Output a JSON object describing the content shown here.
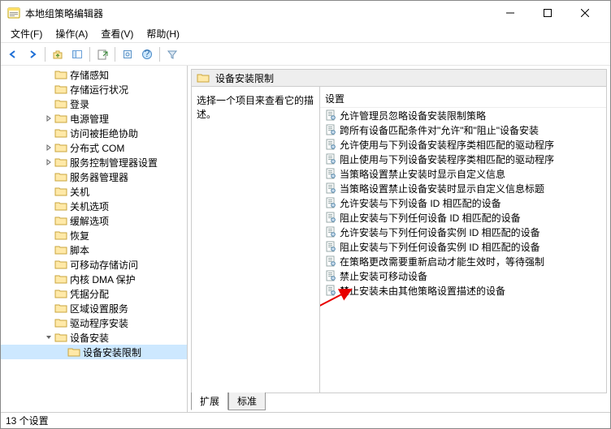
{
  "window": {
    "title": "本地组策略编辑器"
  },
  "menu": {
    "file": "文件(F)",
    "action": "操作(A)",
    "view": "查看(V)",
    "help": "帮助(H)"
  },
  "tree": {
    "items": [
      {
        "label": "存储感知",
        "indent": 3,
        "exp": ""
      },
      {
        "label": "存储运行状况",
        "indent": 3,
        "exp": ""
      },
      {
        "label": "登录",
        "indent": 3,
        "exp": ""
      },
      {
        "label": "电源管理",
        "indent": 3,
        "exp": ">"
      },
      {
        "label": "访问被拒绝协助",
        "indent": 3,
        "exp": ""
      },
      {
        "label": "分布式 COM",
        "indent": 3,
        "exp": ">"
      },
      {
        "label": "服务控制管理器设置",
        "indent": 3,
        "exp": ">"
      },
      {
        "label": "服务器管理器",
        "indent": 3,
        "exp": ""
      },
      {
        "label": "关机",
        "indent": 3,
        "exp": ""
      },
      {
        "label": "关机选项",
        "indent": 3,
        "exp": ""
      },
      {
        "label": "缓解选项",
        "indent": 3,
        "exp": ""
      },
      {
        "label": "恢复",
        "indent": 3,
        "exp": ""
      },
      {
        "label": "脚本",
        "indent": 3,
        "exp": ""
      },
      {
        "label": "可移动存储访问",
        "indent": 3,
        "exp": ""
      },
      {
        "label": "内核 DMA 保护",
        "indent": 3,
        "exp": ""
      },
      {
        "label": "凭据分配",
        "indent": 3,
        "exp": ""
      },
      {
        "label": "区域设置服务",
        "indent": 3,
        "exp": ""
      },
      {
        "label": "驱动程序安装",
        "indent": 3,
        "exp": ""
      },
      {
        "label": "设备安装",
        "indent": 3,
        "exp": "v"
      },
      {
        "label": "设备安装限制",
        "indent": 4,
        "exp": "",
        "selected": true
      }
    ]
  },
  "detail": {
    "header": "设备安装限制",
    "desc_prompt": "选择一个项目来查看它的描述。",
    "settings_header": "设置",
    "settings": [
      "允许管理员忽略设备安装限制策略",
      "跨所有设备匹配条件对\"允许\"和\"阻止\"设备安装",
      "允许使用与下列设备安装程序类相匹配的驱动程序",
      "阻止使用与下列设备安装程序类相匹配的驱动程序",
      "当策略设置禁止安装时显示自定义信息",
      "当策略设置禁止设备安装时显示自定义信息标题",
      "允许安装与下列设备 ID 相匹配的设备",
      "阻止安装与下列任何设备 ID 相匹配的设备",
      "允许安装与下列任何设备实例 ID 相匹配的设备",
      "阻止安装与下列任何设备实例 ID 相匹配的设备",
      "在策略更改需要重新启动才能生效时，等待强制",
      "禁止安装可移动设备",
      "禁止安装未由其他策略设置描述的设备"
    ]
  },
  "tabs": {
    "extended": "扩展",
    "standard": "标准"
  },
  "status": {
    "count": "13 个设置"
  }
}
